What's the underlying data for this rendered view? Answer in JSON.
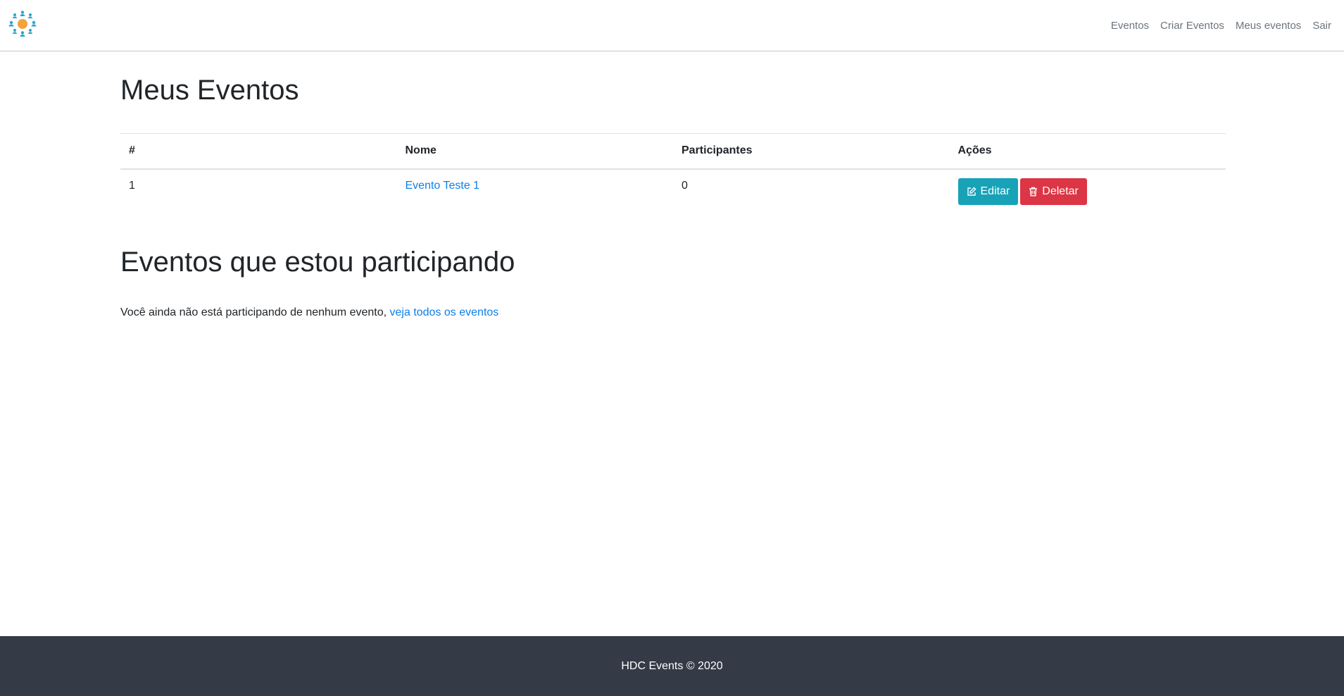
{
  "header": {
    "nav": [
      "Eventos",
      "Criar Eventos",
      "Meus eventos",
      "Sair"
    ]
  },
  "my_events": {
    "title": "Meus Eventos",
    "columns": [
      "#",
      "Nome",
      "Participantes",
      "Ações"
    ],
    "rows": [
      {
        "index": "1",
        "name": "Evento Teste 1",
        "participants": "0"
      }
    ],
    "edit_label": "Editar",
    "delete_label": "Deletar"
  },
  "participating": {
    "title": "Eventos que estou participando",
    "empty_text": "Você ainda não está participando de nenhum evento,",
    "link_text": "veja todos os eventos"
  },
  "footer": {
    "text": "HDC Events © 2020"
  },
  "colors": {
    "link": "#0d7ee8",
    "edit_button": "#17a2b8",
    "delete_button": "#dc3545",
    "footer_bg": "#343a46"
  },
  "icons": {
    "logo": "people-network-logo",
    "edit": "edit-icon",
    "delete": "trash-icon"
  }
}
